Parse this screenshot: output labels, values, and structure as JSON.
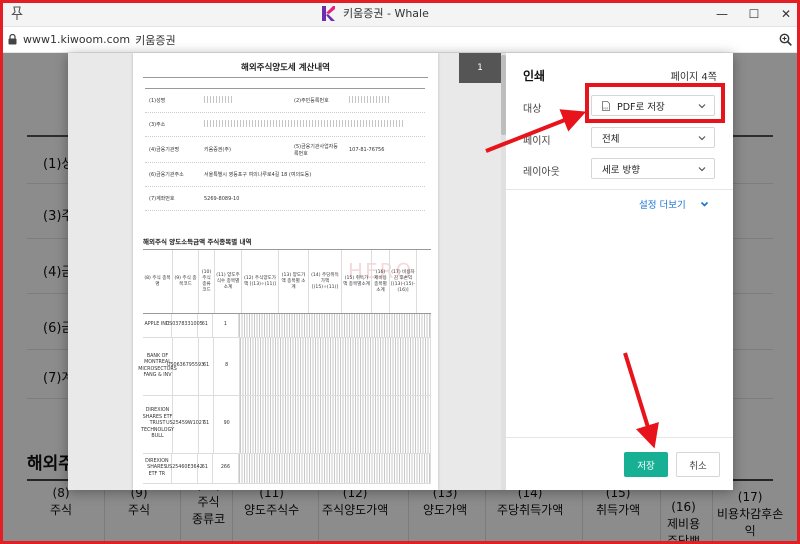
{
  "window": {
    "title": "키움증권 - Whale",
    "minimize_glyph": "—",
    "maximize_glyph": "☐",
    "close_glyph": "✕"
  },
  "address": {
    "url": "www1.kiwoom.com",
    "site_name": "키움증권"
  },
  "background": {
    "rows": [
      "(1)성",
      "(3)주",
      "(4)금",
      "(6)금",
      "(7)계"
    ],
    "section_title": "해외주",
    "column_headers": [
      {
        "num": "(8)",
        "label": "주식"
      },
      {
        "num": "(9)",
        "label": "주식"
      },
      {
        "num": "(10)",
        "label": "주식",
        "extra": "종류코"
      },
      {
        "num": "(11)",
        "label": "양도주식수"
      },
      {
        "num": "(12)",
        "label": "주식양도가액"
      },
      {
        "num": "(13)",
        "label": "양도가액"
      },
      {
        "num": "(14)",
        "label": "주당취득가액"
      },
      {
        "num": "(15)",
        "label": "취득가액"
      },
      {
        "num": "(16)",
        "label": "제비용",
        "extra": "주당쁘"
      },
      {
        "num": "(17)",
        "label": "비용차감후손",
        "extra": "익"
      }
    ]
  },
  "preview": {
    "page_number": "1",
    "doc_title": "해외주식양도세 계산내역",
    "info": [
      {
        "label": "(1)성명",
        "label2": "(2)주민등록번호"
      },
      {
        "label": "(3)주소"
      },
      {
        "label": "(4)금융기관명",
        "value": "키움증권(주)",
        "label2": "(5)금융기관사업자등록번호",
        "value2": "107-81-76756"
      },
      {
        "label": "(6)금융기관주소",
        "value": "서울특별시 영등포구 여의나루로4길 18 (여의도동)"
      },
      {
        "label": "(7)계좌번호",
        "value": "5269-8089-10"
      }
    ],
    "sub_title": "해외주식 양도소득금액 주식종목별 내역",
    "watermark": "HERO",
    "table_headers": [
      "(8) 주식 종목명",
      "(9) 주식 종목코드",
      "(10) 주식 종류 코드",
      "(11) 양도주식수 종목별소계",
      "(12) 주식양도가액 [(13)÷(11)]",
      "(13) 양도가액 종목별 소계",
      "(14) 주당취득가액 [(15)÷(11)]",
      "(15) 취득가액 종목별소계",
      "(16) 제비용 종목별소계",
      "(17) 비용차감 후손익 [(13)-(15)-(16)]"
    ],
    "rows": [
      {
        "name": "APPLE INC",
        "code": "US0378331005",
        "type": "61",
        "qty": "1"
      },
      {
        "name": "BANK OF MONTREAL MICROSECTORS FANG & INV",
        "code": "US0636795593",
        "type": "61",
        "qty": "8"
      },
      {
        "name": "DIREXION SHARES ETF TRUST TECHNOLOGY BULL",
        "code": "US25459W1027",
        "type": "61",
        "qty": "90"
      },
      {
        "name": "DIREXION SHARES ETF TR",
        "code": "US25460E3642",
        "type": "61",
        "qty": "266"
      }
    ]
  },
  "settings": {
    "title": "인쇄",
    "page_count": "페이지 4쪽",
    "destination_label": "대상",
    "destination_value": "PDF로 저장",
    "pages_label": "페이지",
    "pages_value": "전체",
    "layout_label": "레이아웃",
    "layout_value": "세로 방향",
    "more_settings": "설정 더보기",
    "save_button": "저장",
    "cancel_button": "취소"
  },
  "colors": {
    "accent_save": "#17b095",
    "annotation_red": "#e8141b",
    "link_blue": "#1c73d4"
  }
}
